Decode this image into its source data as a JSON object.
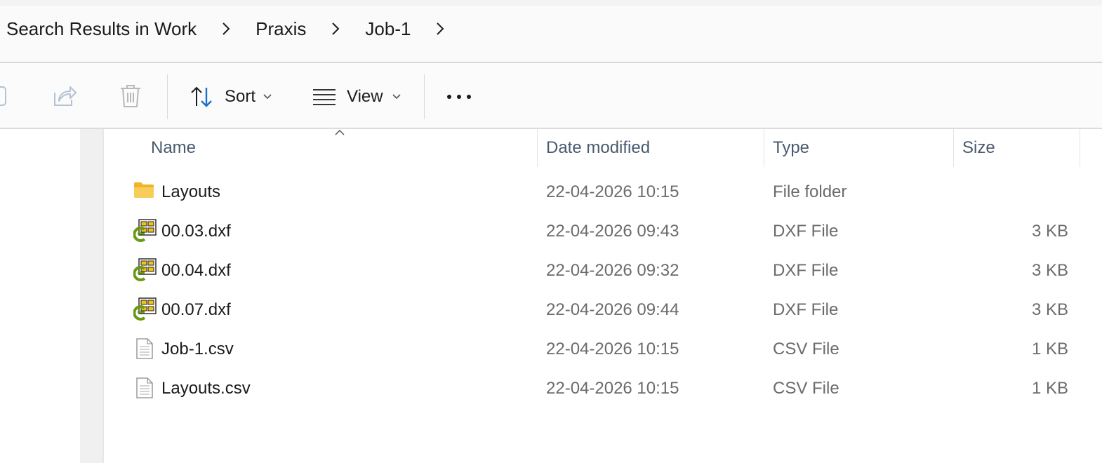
{
  "breadcrumb": {
    "items": [
      "Search Results in Work",
      "Praxis",
      "Job-1"
    ]
  },
  "toolbar": {
    "sort_label": "Sort",
    "view_label": "View",
    "icons": [
      "copy-icon",
      "share-icon",
      "delete-icon",
      "sort-icon",
      "view-icon",
      "more-icon"
    ]
  },
  "columns": {
    "name": "Name",
    "date": "Date modified",
    "type": "Type",
    "size": "Size"
  },
  "files": [
    {
      "name": "Layouts",
      "date": "22-04-2026 10:15",
      "type": "File folder",
      "size": "",
      "icon": "folder-icon"
    },
    {
      "name": "00.03.dxf",
      "date": "22-04-2026 09:43",
      "type": "DXF File",
      "size": "3 KB",
      "icon": "dxf-file-icon"
    },
    {
      "name": "00.04.dxf",
      "date": "22-04-2026 09:32",
      "type": "DXF File",
      "size": "3 KB",
      "icon": "dxf-file-icon"
    },
    {
      "name": "00.07.dxf",
      "date": "22-04-2026 09:44",
      "type": "DXF File",
      "size": "3 KB",
      "icon": "dxf-file-icon"
    },
    {
      "name": "Job-1.csv",
      "date": "22-04-2026 10:15",
      "type": "CSV File",
      "size": "1 KB",
      "icon": "csv-file-icon"
    },
    {
      "name": "Layouts.csv",
      "date": "22-04-2026 10:15",
      "type": "CSV File",
      "size": "1 KB",
      "icon": "csv-file-icon"
    }
  ],
  "colors": {
    "accent": "#1a73c8",
    "folder": "#f5c242",
    "header_text": "#4a5a6e",
    "secondary_text": "#6b6b6b"
  }
}
